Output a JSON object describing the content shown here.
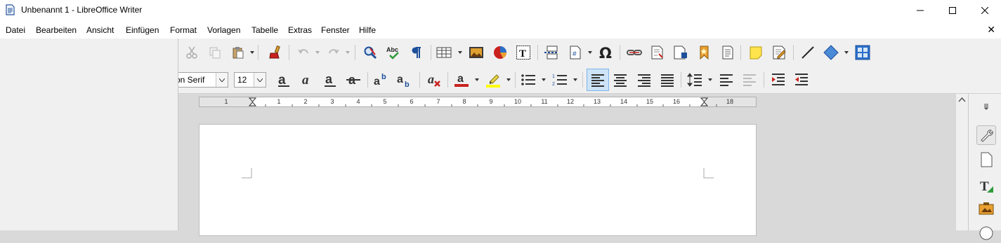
{
  "window": {
    "title": "Unbenannt 1 - LibreOffice Writer",
    "controls": {
      "minimize": "—",
      "maximize": "☐",
      "close": "✕"
    }
  },
  "menu": {
    "items": [
      "Datei",
      "Bearbeiten",
      "Ansicht",
      "Einfügen",
      "Format",
      "Vorlagen",
      "Tabelle",
      "Extras",
      "Fenster",
      "Hilfe"
    ],
    "doc_close": "✕"
  },
  "formatting": {
    "font_name": "on Serif",
    "font_size": "12"
  },
  "ruler": {
    "numbers": [
      "1",
      "1",
      "2",
      "3",
      "4",
      "5",
      "6",
      "7",
      "8",
      "9",
      "10",
      "11",
      "12",
      "13",
      "14",
      "15",
      "16",
      "18"
    ]
  },
  "icons": {
    "standard_toolbar": [
      "cut-icon",
      "copy-icon",
      "paste-icon",
      "clone-formatting-icon",
      "undo-icon",
      "redo-icon",
      "find-replace-icon",
      "spellcheck-icon",
      "formatting-marks-icon",
      "table-icon",
      "image-icon",
      "chart-icon",
      "textbox-icon",
      "page-break-icon",
      "field-icon",
      "special-character-icon",
      "hyperlink-icon",
      "footnote-icon",
      "endnote-icon",
      "bookmark-icon",
      "cross-reference-icon",
      "comment-icon",
      "track-changes-icon",
      "line-icon",
      "basic-shapes-icon",
      "sidebar-toggle-icon"
    ],
    "formatting_toolbar": [
      "bold-icon",
      "italic-icon",
      "underline-icon",
      "strikethrough-icon",
      "superscript-icon",
      "subscript-icon",
      "clear-formatting-icon",
      "font-color-icon",
      "highlight-icon",
      "unordered-list-icon",
      "ordered-list-icon",
      "align-left-icon",
      "align-center-icon",
      "align-right-icon",
      "justify-icon",
      "line-spacing-icon",
      "increase-paragraph-spacing-icon",
      "decrease-paragraph-spacing-icon",
      "increase-indent-icon",
      "decrease-indent-icon"
    ]
  },
  "colors": {
    "font_color": "#c9211e",
    "highlight_color": "#ffff00",
    "accent": "#1e4f9a"
  }
}
